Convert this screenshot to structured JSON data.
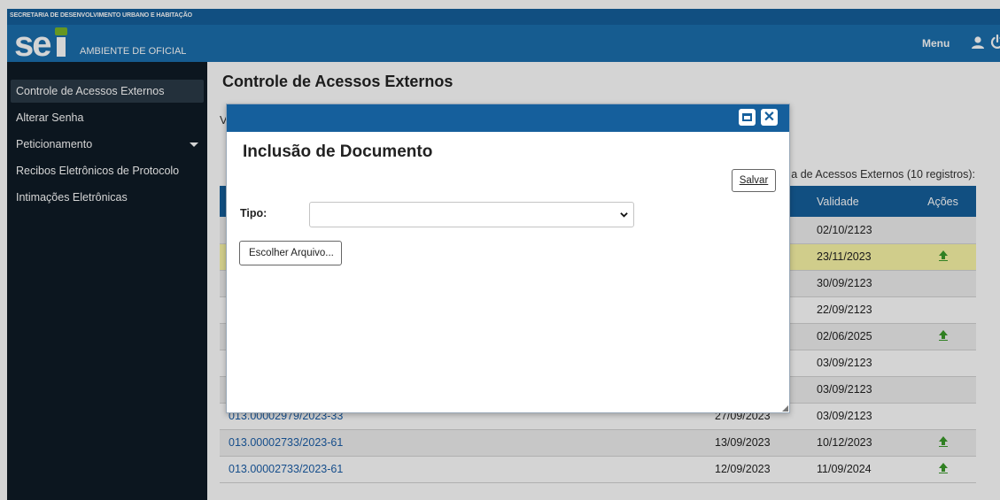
{
  "header": {
    "org_name": "SECRETARIA DE DESENVOLVIMENTO URBANO E HABITAÇÃO",
    "logo_text": "sei",
    "environment": "AMBIENTE DE OFICIAL",
    "menu_label": "Menu",
    "icons": [
      "user-icon",
      "power-icon"
    ],
    "colors": {
      "top_bar": "#155f9c",
      "header": "#1b6fae",
      "logo_dot": "#7bb52a"
    }
  },
  "sidebar": {
    "items": [
      {
        "label": "Controle de Acessos Externos",
        "active": true
      },
      {
        "label": "Alterar Senha"
      },
      {
        "label": "Peticionamento",
        "has_submenu": true
      },
      {
        "label": "Recibos Eletrônicos de Protocolo"
      },
      {
        "label": "Intimações Eletrônicas"
      }
    ]
  },
  "main": {
    "title": "Controle de Acessos Externos",
    "cut_text": "V",
    "table_caption": "a de Acessos Externos (10 registros):",
    "table": {
      "headers": [
        "",
        "",
        "Validade",
        "Ações"
      ],
      "rows": [
        {
          "processo": "",
          "data": "",
          "validade": "02/10/2123",
          "acao": false
        },
        {
          "processo": "",
          "data": "",
          "validade": "23/11/2023",
          "acao": true,
          "highlight": true
        },
        {
          "processo": "",
          "data": "",
          "validade": "30/09/2123",
          "acao": false
        },
        {
          "processo": "",
          "data": "",
          "validade": "22/09/2123",
          "acao": false
        },
        {
          "processo": "",
          "data": "",
          "validade": "02/06/2025",
          "acao": true
        },
        {
          "processo": "",
          "data": "",
          "validade": "03/09/2123",
          "acao": false
        },
        {
          "processo": "",
          "data": "",
          "validade": "03/09/2123",
          "acao": false
        },
        {
          "processo": "013.00002979/2023-33",
          "data": "27/09/2023",
          "validade": "03/09/2123",
          "acao": false
        },
        {
          "processo": "013.00002733/2023-61",
          "data": "13/09/2023",
          "validade": "10/12/2023",
          "acao": true
        },
        {
          "processo": "013.00002733/2023-61",
          "data": "12/09/2023",
          "validade": "11/09/2024",
          "acao": true
        }
      ]
    }
  },
  "modal": {
    "title": "Inclusão de Documento",
    "save_label": "Salvar",
    "tipo_label": "Tipo:",
    "tipo_value": "",
    "file_button_label": "Escolher Arquivo...",
    "icons": [
      "maximize-icon",
      "close-icon"
    ]
  }
}
